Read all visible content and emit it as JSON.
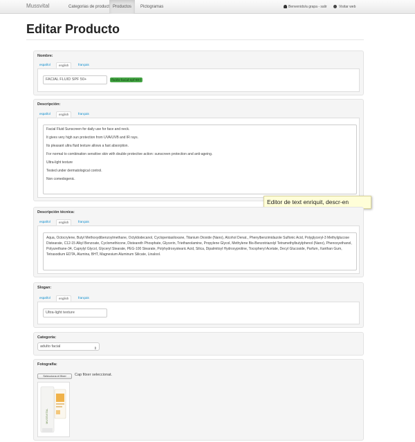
{
  "navbar": {
    "brand": "Mussvital",
    "items": [
      {
        "label": "Categorias de productos",
        "active": false
      },
      {
        "label": "Productos",
        "active": true
      },
      {
        "label": "Pictogramas",
        "active": false
      }
    ],
    "user_label": "Benvenido/a grapa - salir",
    "visit_label": "Visitar web"
  },
  "page": {
    "title": "Editar Producto"
  },
  "languages": [
    "español",
    "english",
    "français"
  ],
  "nombre": {
    "label": "Nombre:",
    "active_tab": 1,
    "value": "FACIAL FLUID SPF 50+",
    "slug": "fluido-facial-spf-50-l"
  },
  "descripcion": {
    "label": "Descripción:",
    "active_tab": 1,
    "paragraphs": [
      "Facial Fluid Sunscreen for daily use for face and neck.",
      "It gives very high sun protection from UVA/UVB and IR rays.",
      "Its pleasant ultra fluid texture allows a fast absorption.",
      "For normal to combination sensitive skin with double protective action: sunscreen protection and anti-ageing.",
      "Ultra-light texture",
      "Tested under dermatological control.",
      "Non comedogenic."
    ]
  },
  "tooltip": "Editor de text enriquit, descr-en",
  "descripcion_tecnica": {
    "label": "Descripción técnica:",
    "active_tab": 1,
    "text": "Aqua, Octocrylene, Butyl Methoxydibenzoylmethane, Octyldodecanol, Cyclopentasiloxane, Titanium Dioxide (Nano), Alcohol Denat., Phenylbenzimidazole Sulfonic Acid, Polyglyceryl-3 Methylglucose Distearate, C12-15 Alkyl Benzoate, Cyclomethicone, Disteareth Phosphate, Glycerin, Triethanolamine, Propylene Glycol, Methylene Bis-Benzotriazolyl Tetramethylbutylphenol (Nano), Phenoxyethanol, Polyurethane-34, Caprylyl Glycol, Glyceryl Stearate, PEG-100 Stearate, Polyhydroxystearic Acid, Silica, Dipalmitoyl Hydroxyproline, Tocopheryl Acetate, Decyl Glucoside, Parfum, Xanthan Gum, Tetrasodium EDTA, Alumina, BHT, Magnesium Aluminum Silicate, Linalool."
  },
  "slogan": {
    "label": "Slogan:",
    "active_tab": 1,
    "value": "Ultra-light texture"
  },
  "categoria": {
    "label": "Categoría:",
    "selected": "adulto facial"
  },
  "fotografia": {
    "label": "Fotografía:",
    "button_label": "Selecciona el fitxer",
    "status": "Cap fitxer seleccionat.",
    "product_brand": "MUSSVITAL"
  },
  "colors": {
    "navbar_bg": "#f2f2f2",
    "panel_bg": "#f5f5f5",
    "link": "#0088cc",
    "slug_badge": "#46a546",
    "tooltip_bg": "#fffed8"
  }
}
